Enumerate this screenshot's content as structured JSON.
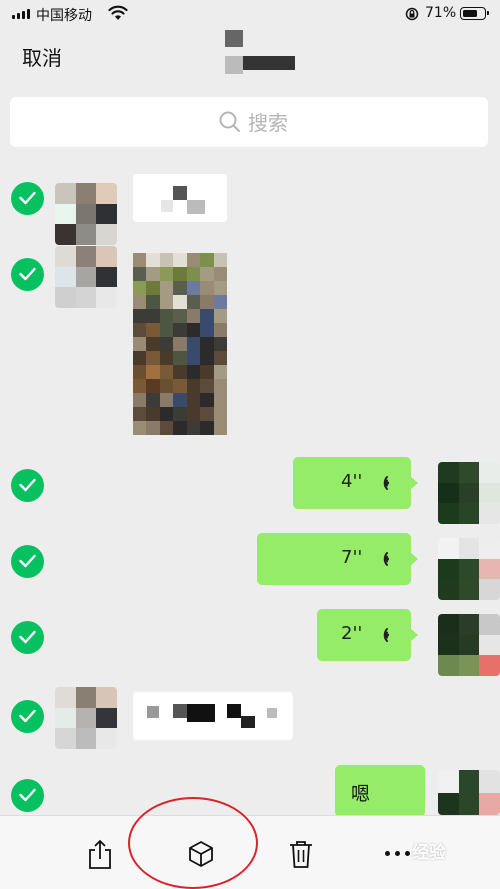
{
  "status_bar": {
    "carrier": "中国移动",
    "battery_percent": "71%",
    "battery_level": 0.71
  },
  "nav": {
    "cancel_label": "取消"
  },
  "search": {
    "placeholder": "搜索"
  },
  "messages": [
    {
      "side": "left",
      "kind": "text",
      "selected": true
    },
    {
      "side": "left",
      "kind": "image",
      "selected": true
    },
    {
      "side": "right",
      "kind": "voice",
      "duration": "4''",
      "selected": true
    },
    {
      "side": "right",
      "kind": "voice",
      "duration": "7''",
      "selected": true
    },
    {
      "side": "right",
      "kind": "voice",
      "duration": "2''",
      "selected": true
    },
    {
      "side": "left",
      "kind": "text",
      "selected": true
    },
    {
      "side": "right",
      "kind": "text",
      "text": "嗯",
      "selected": true
    }
  ],
  "toolbar": {
    "icons": [
      "share-icon",
      "favorite-box-icon",
      "trash-icon",
      "more-icon"
    ]
  },
  "watermark": {
    "text": "经验"
  },
  "colors": {
    "check_green": "#07c160",
    "bubble_green": "#95ec69",
    "highlight_red": "#d8232a"
  }
}
